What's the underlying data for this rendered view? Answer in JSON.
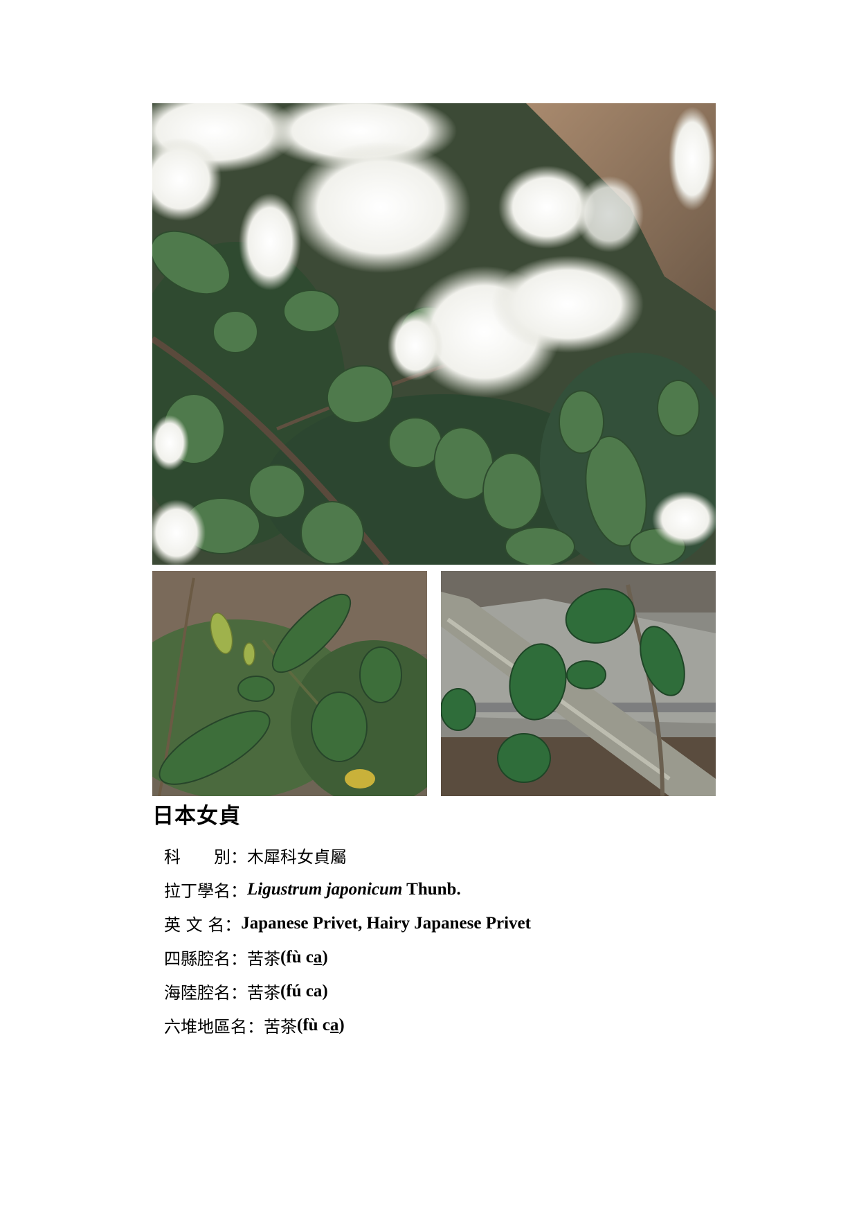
{
  "images": {
    "main": "flowering shrub with white flower clusters and dark green leaves",
    "left": "shrub branch with glossy green leaves",
    "right": "branch with oval leaves next to a grey trunk"
  },
  "title": "日本女貞",
  "rows": [
    {
      "label": "科　　別",
      "colon": "：",
      "value": "木犀科女貞屬"
    },
    {
      "label": "拉丁學名",
      "colon": "：",
      "value_italic": "Ligustrum japonicum",
      "value_plain": " Thunb."
    },
    {
      "label": "英 文 名",
      "colon": "：",
      "value": "Japanese Privet, Hairy Japanese Privet"
    },
    {
      "label": "四縣腔名",
      "colon": "：",
      "value_cjk": "苦茶",
      "value_a": "(fù c",
      "value_u": "a",
      "value_b": ")"
    },
    {
      "label": "海陸腔名",
      "colon": "：",
      "value_cjk": "苦茶",
      "value_a": "(fú ca)"
    },
    {
      "label": "六堆地區名",
      "colon": "：",
      "value_cjk": "苦茶",
      "value_a": "(fù c",
      "value_u": "a",
      "value_b": ")"
    }
  ]
}
